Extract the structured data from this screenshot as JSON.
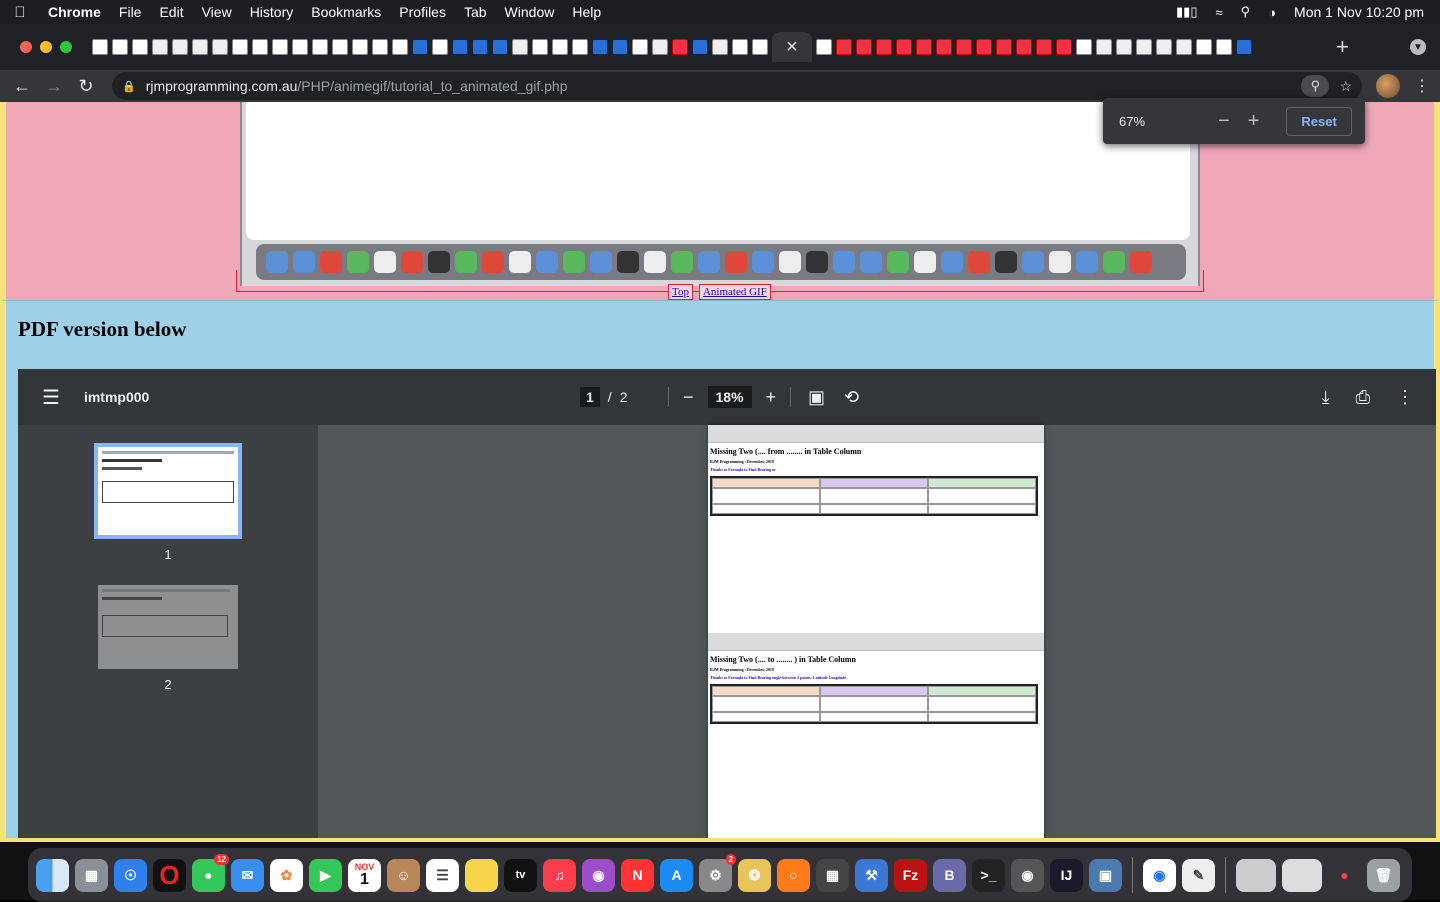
{
  "menubar": {
    "app": "Chrome",
    "items": [
      "File",
      "Edit",
      "View",
      "History",
      "Bookmarks",
      "Profiles",
      "Tab",
      "Window",
      "Help"
    ],
    "clock": "Mon 1 Nov  10:20 pm"
  },
  "browser": {
    "url_host": "rjmprogramming.com.au",
    "url_path": "/PHP/animegif/tutorial_to_animated_gif.php",
    "zoom_popup": {
      "percent": "67%",
      "minus": "−",
      "plus": "+",
      "reset": "Reset"
    }
  },
  "page": {
    "links": {
      "top": "Top",
      "animated_gif": "Animated GIF"
    },
    "heading": "PDF version below"
  },
  "pdf_viewer": {
    "filename": "imtmp000",
    "current_page": "1",
    "page_sep": "/",
    "total_pages": "2",
    "zoom": "18%",
    "thumbnails": [
      "1",
      "2"
    ],
    "page1_title": "Missing Two (.... from",
    "page1_title_end": "in Table Column",
    "page2_title": "Missing Two (.... to",
    "page2_title_end": ") in Table Column",
    "page_sub": "RJM Programming : December, 2018",
    "page_thanks_1": "Thanks to Formula to Find Bearing or",
    "page_thanks_2": "Thanks to Formula to Find Bearing angle between 2 points: Latitude Longitude"
  },
  "dock": {
    "messages_badge": "12",
    "calendar_month": "NOV",
    "calendar_day": "1",
    "settings_badge": "2"
  }
}
